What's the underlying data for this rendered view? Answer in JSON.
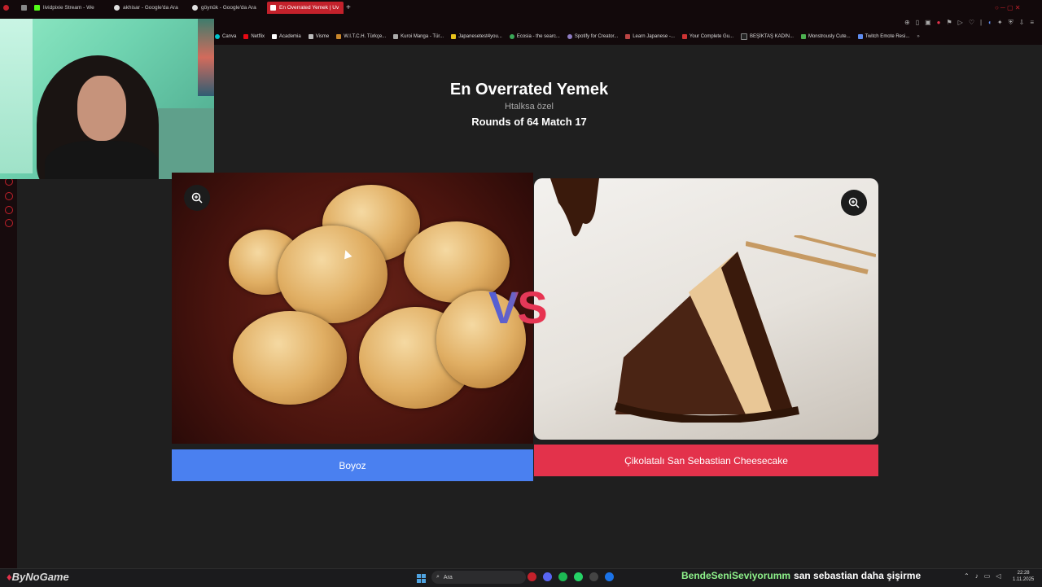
{
  "browser": {
    "tabs": [
      {
        "label": "lividpixie Stream - We",
        "color": "#53fc18"
      },
      {
        "label": "akhisar - Google'da Ara",
        "color": "#e0e0e0"
      },
      {
        "label": "göynük - Google'da Ara",
        "color": "#e0e0e0"
      },
      {
        "label": "En Overrated Yemek | Uv",
        "color": "#ffffff"
      }
    ],
    "new_tab": "+",
    "bookmarks": [
      "Canva",
      "Netflix",
      "Academia",
      "Visme",
      "W.I.T.C.H. Türkçe...",
      "Kuroi Manga - Tür...",
      "Japanesetest4you...",
      "Ecosia - the searc...",
      "Spotify for Creator...",
      "Learn Japanese -...",
      "Your Complete Gu...",
      "BEŞİKTAŞ KADIN...",
      "Monstrously Cute...",
      "Twitch Emote Resi..."
    ]
  },
  "page": {
    "title": "En Overrated Yemek",
    "subtitle": "Htalksa özel",
    "round": "Rounds of 64 Match 17"
  },
  "vs_text": "VS",
  "left": {
    "label": "Boyoz",
    "color": "#4a80f0"
  },
  "right": {
    "label": "Çikolatalı San Sebastian Cheesecake",
    "color": "#e3324b"
  },
  "overlay": {
    "brand": "ByNoGame"
  },
  "taskbar": {
    "search_placeholder": "Ara",
    "clock_time": "22:28",
    "clock_date": "1.11.2025"
  },
  "chat": {
    "user": "BendeSeniSeviyorumm",
    "message": "san sebastian daha şişirme"
  }
}
